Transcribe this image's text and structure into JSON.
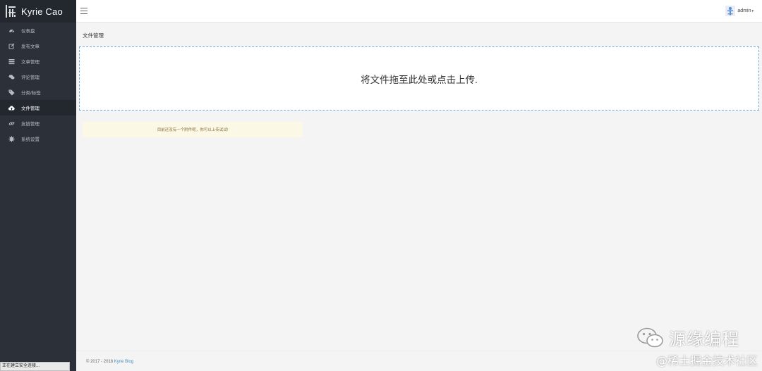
{
  "brand": {
    "name": "Kyrie Cao"
  },
  "sidebar": {
    "items": [
      {
        "label": "仪表盘",
        "icon": "dashboard-icon"
      },
      {
        "label": "发布文章",
        "icon": "edit-icon"
      },
      {
        "label": "文章管理",
        "icon": "list-icon"
      },
      {
        "label": "评论管理",
        "icon": "comments-icon"
      },
      {
        "label": "分类/标签",
        "icon": "tags-icon"
      },
      {
        "label": "文件管理",
        "icon": "cloud-upload-icon",
        "active": true
      },
      {
        "label": "友链管理",
        "icon": "link-icon"
      },
      {
        "label": "系统设置",
        "icon": "gear-icon"
      }
    ]
  },
  "header": {
    "user_name": "admin",
    "caret": "▾"
  },
  "main": {
    "title": "文件管理",
    "dropzone_text": "将文件拖至此处或点击上传.",
    "notice": "目前还没有一个附件呢，你可以上传试试!"
  },
  "footer": {
    "copyright": "© 2017 - 2018 ",
    "link_text": "Kyrie Blog"
  },
  "status_bar": {
    "text": "正在建立安全连接..."
  },
  "watermark": {
    "line1": "源缘编程",
    "line2": "@稀土掘金技术社区"
  },
  "colors": {
    "sidebar_bg": "#2c3038",
    "active_bg": "#23272e",
    "link": "#3c8dbc",
    "notice_bg": "#fbf8e5",
    "dropzone_border": "#6fa8dc"
  }
}
